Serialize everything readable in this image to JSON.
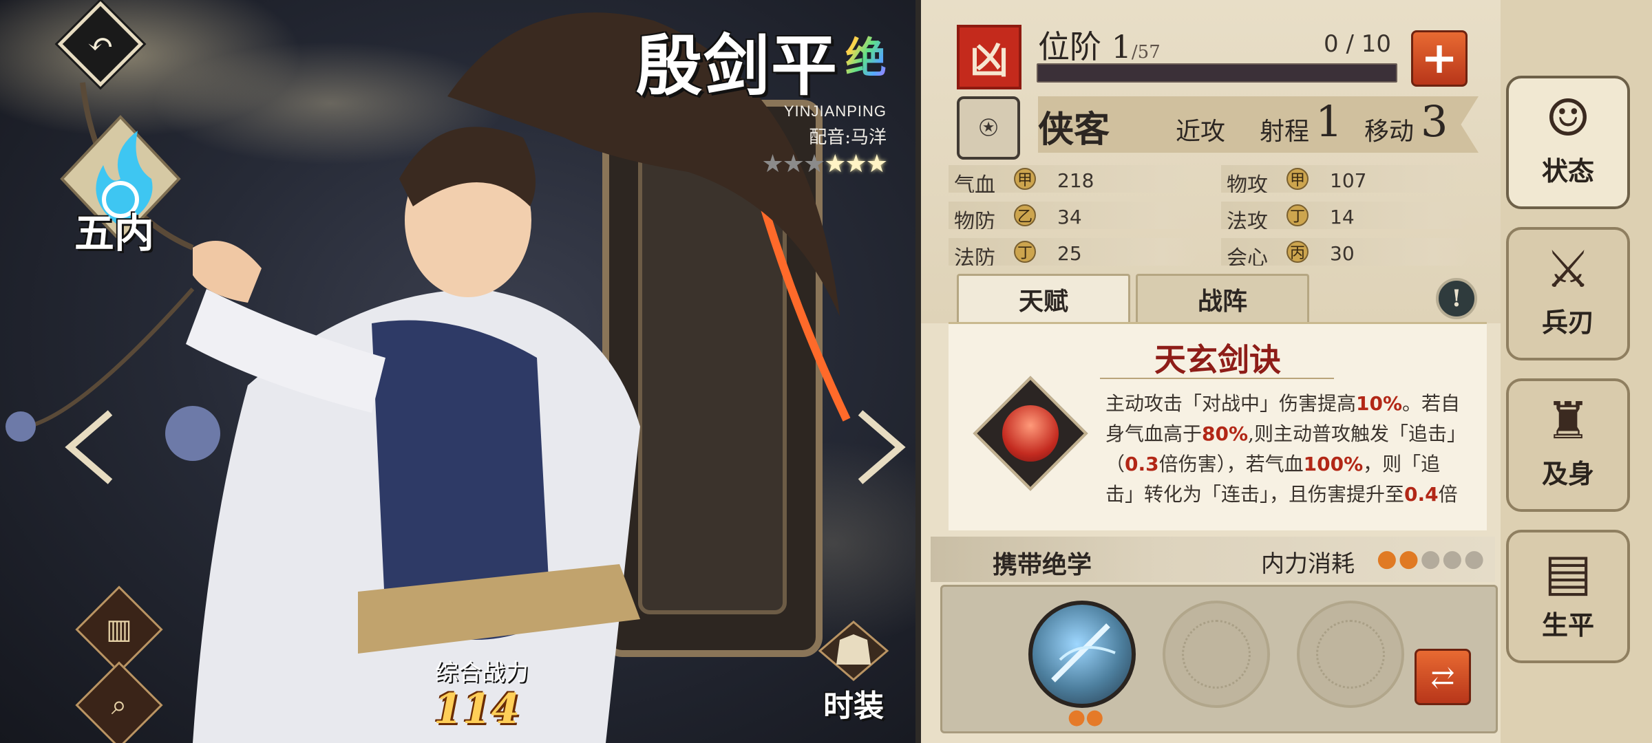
{
  "hero": {
    "name": "殷剑平",
    "rarity_label": "绝",
    "pinyin": "YINJIANPING",
    "voice_actor": "配音:马洋",
    "stars_total": 6,
    "stars_filled": 3,
    "soul_label": "五内",
    "combat_power_label": "综合战力",
    "combat_power_value": "114",
    "outfit_label": "时装"
  },
  "left_controls": {
    "back_icon": "back-icon",
    "archive_icon": "scroll-icon",
    "search_icon": "magnifier-icon"
  },
  "rank": {
    "seal_icon": "seal-icon",
    "label": "位阶",
    "level": "1",
    "max": "/57",
    "progress_text": "0 / 10",
    "progress_fraction": 0,
    "upgrade_icon": "plus-icon"
  },
  "class": {
    "name": "侠客",
    "attack_type": "近攻",
    "range_label": "射程",
    "range_value": "1",
    "move_label": "移动",
    "move_value": "3"
  },
  "stats": [
    {
      "name": "气血",
      "grade": "甲",
      "value": "218"
    },
    {
      "name": "物攻",
      "grade": "甲",
      "value": "107"
    },
    {
      "name": "物防",
      "grade": "乙",
      "value": "34"
    },
    {
      "name": "法攻",
      "grade": "丁",
      "value": "14"
    },
    {
      "name": "法防",
      "grade": "丁",
      "value": "25"
    },
    {
      "name": "会心",
      "grade": "丙",
      "value": "30"
    }
  ],
  "tabs": {
    "talent": "天赋",
    "formation": "战阵"
  },
  "talent": {
    "title": "天玄剑诀",
    "desc": [
      {
        "t": "主动攻击「对战中」伤害提高"
      },
      {
        "t": "10%",
        "hl": true
      },
      {
        "t": "。若自身气血高于"
      },
      {
        "t": "80%",
        "hl": true
      },
      {
        "t": ",则主动普攻触发「追击」（"
      },
      {
        "t": "0.3",
        "hl": true
      },
      {
        "t": "倍伤害），若气血"
      },
      {
        "t": "100%",
        "hl": true
      },
      {
        "t": "，则「追击」转化为「连击」，且伤害提升至"
      },
      {
        "t": "0.4",
        "hl": true
      },
      {
        "t": "倍"
      }
    ]
  },
  "skills": {
    "header": "携带绝学",
    "mp_cost_label": "内力消耗",
    "mp_cost": 2,
    "mp_max": 5,
    "slot1_cost_drops": 2
  },
  "side_tabs": [
    {
      "label": "状态",
      "icon": "portrait-icon",
      "glyph": "☺",
      "active": true
    },
    {
      "label": "兵刃",
      "icon": "blade-icon",
      "glyph": "⚔",
      "active": false
    },
    {
      "label": "及身",
      "icon": "armor-icon",
      "glyph": "♜",
      "active": false
    },
    {
      "label": "生平",
      "icon": "book-icon",
      "glyph": "▤",
      "active": false
    }
  ]
}
